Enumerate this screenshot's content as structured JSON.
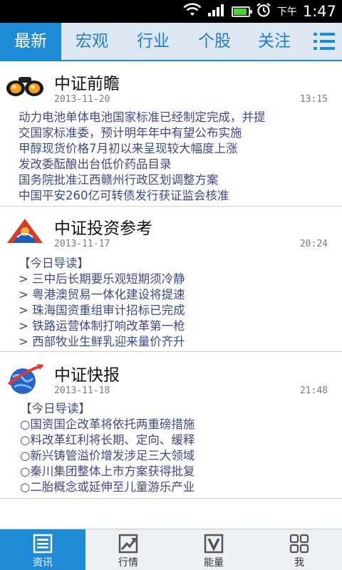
{
  "status_bar": {
    "ampm": "下午",
    "time": "1:47",
    "icons": [
      "wifi-icon",
      "signal-icon",
      "battery-icon",
      "alarm-icon"
    ]
  },
  "tabs": [
    {
      "label": "最新",
      "active": true
    },
    {
      "label": "宏观",
      "active": false
    },
    {
      "label": "行业",
      "active": false
    },
    {
      "label": "个股",
      "active": false
    },
    {
      "label": "关注",
      "active": false
    }
  ],
  "menu_icon": "list-menu-icon",
  "feed": [
    {
      "logo": "binoculars-icon",
      "title": "中证前瞻",
      "date": "2013-11-20",
      "time": "13:15",
      "lines": [
        "动力电池单体电池国家标准已经制定完成，并提",
        "交国家标准委，预计明年年中有望公布实施",
        "甲醇现货价格7月初以来呈现较大幅度上涨",
        "发改委酝酿出台低价药品目录",
        "国务院批准江西赣州行政区划调整方案",
        "中国平安260亿可转债发行获证监会核准"
      ]
    },
    {
      "logo": "investment-reference-logo",
      "title": "中证投资参考",
      "date": "2013-11-17",
      "time": "20:24",
      "lines": [
        "【今日导读】",
        "> 三中后长期要乐观短期须冷静",
        "> 粤港澳贸易一体化建设将提速",
        "> 珠海国资重组审计招标已完成",
        "> 铁路运营体制打响改革第一枪",
        "> 西部牧业生鲜乳迎来量价齐升"
      ]
    },
    {
      "logo": "globe-express-logo",
      "title": "中证快报",
      "date": "2013-11-18",
      "time": "21:48",
      "lines": [
        "【今日导读】",
        "○国资国企改革将依托两重磅措施",
        "○料改革红利将长期、定向、缓释",
        "○新兴铸管溢价增发涉足三大领域",
        "○秦川集团整体上市方案获得批复",
        "○二胎概念或延伸至儿童游乐产业"
      ]
    }
  ],
  "bottom_nav": [
    {
      "label": "资讯",
      "icon": "news-icon",
      "active": true
    },
    {
      "label": "行情",
      "icon": "chart-trend-icon",
      "active": false
    },
    {
      "label": "能量",
      "icon": "energy-v-icon",
      "active": false
    },
    {
      "label": "我",
      "icon": "grid-profile-icon",
      "active": false
    }
  ],
  "colors": {
    "accent": "#1f8ad6",
    "tab_bg": "#dde7f2",
    "headline_text": "#3c4a8a",
    "status_bar": "#000000"
  }
}
